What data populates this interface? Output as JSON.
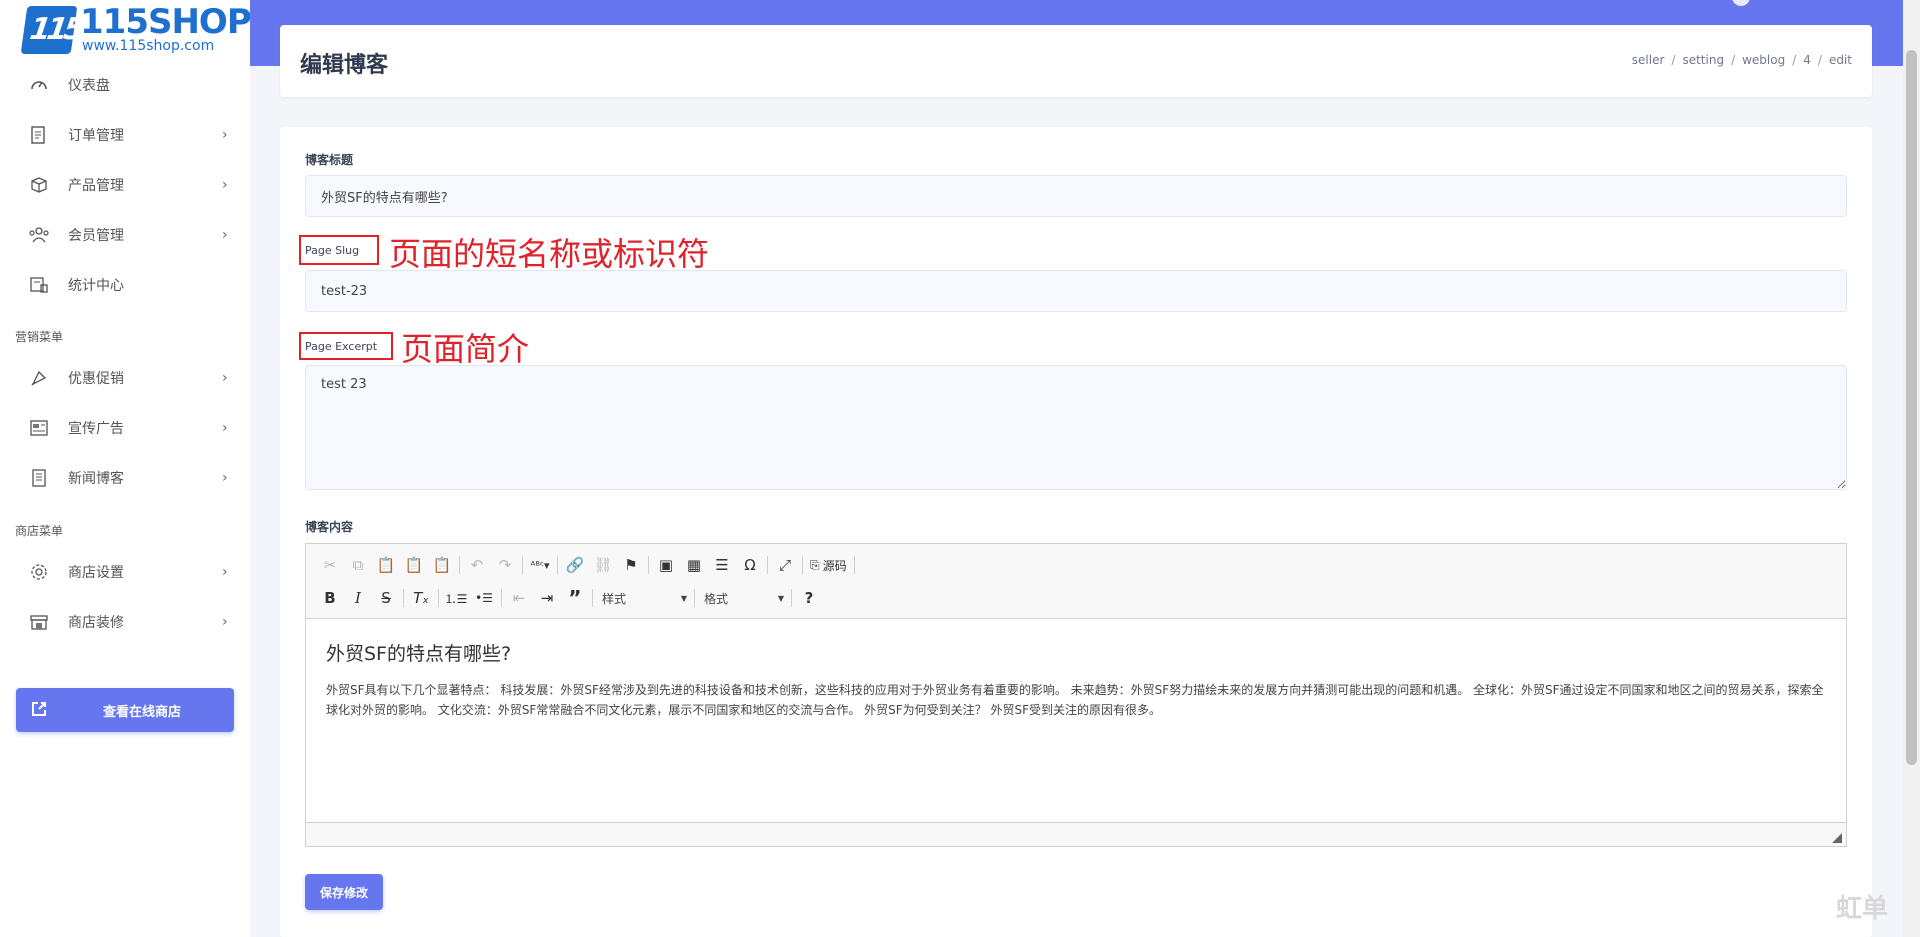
{
  "brand": {
    "name": "115SHOP",
    "url": "www.115shop.com",
    "mark": "115"
  },
  "sidebar": {
    "items": [
      {
        "label": "仪表盘",
        "icon": "dashboard-icon",
        "arrow": ""
      },
      {
        "label": "订单管理",
        "icon": "order-icon",
        "arrow": "›"
      },
      {
        "label": "产品管理",
        "icon": "product-icon",
        "arrow": "›"
      },
      {
        "label": "会员管理",
        "icon": "members-icon",
        "arrow": "›"
      },
      {
        "label": "统计中心",
        "icon": "stats-icon",
        "arrow": ""
      }
    ],
    "section_marketing": "营销菜单",
    "marketing_items": [
      {
        "label": "优惠促销",
        "icon": "promotion-icon",
        "arrow": "›"
      },
      {
        "label": "宣传广告",
        "icon": "ads-icon",
        "arrow": "›"
      },
      {
        "label": "新闻博客",
        "icon": "news-icon",
        "arrow": "›"
      }
    ],
    "section_shop": "商店菜单",
    "shop_items": [
      {
        "label": "商店设置",
        "icon": "settings-icon",
        "arrow": "›"
      },
      {
        "label": "商店装修",
        "icon": "decoration-icon",
        "arrow": "›"
      }
    ],
    "view_shop_button": "查看在线商店"
  },
  "header": {
    "title": "编辑博客",
    "breadcrumb": [
      "seller",
      "setting",
      "weblog",
      "4",
      "edit"
    ],
    "separator": "/"
  },
  "form": {
    "title_label": "博客标题",
    "title_value": "外贸SF的特点有哪些?",
    "slug_label": "Page Slug",
    "slug_annotation": "页面的短名称或标识符",
    "slug_value": "test-23",
    "excerpt_label": "Page Excerpt",
    "excerpt_annotation": "页面简介",
    "excerpt_value": "test 23",
    "content_label": "博客内容",
    "save_button": "保存修改"
  },
  "editor": {
    "source_label": "源码",
    "style_combo": "样式",
    "format_combo": "格式",
    "heading": "外贸SF的特点有哪些?",
    "body": "外贸SF具有以下几个显著特点： 科技发展：外贸SF经常涉及到先进的科技设备和技术创新，这些科技的应用对于外贸业务有着重要的影响。 未来趋势：外贸SF努力描绘未来的发展方向并猜测可能出现的问题和机遇。 全球化：外贸SF通过设定不同国家和地区之间的贸易关系，探索全球化对外贸的影响。 文化交流：外贸SF常常融合不同文化元素，展示不同国家和地区的交流与合作。 外贸SF为何受到关注？ 外贸SF受到关注的原因有很多。"
  },
  "watermark": "虹单",
  "colors": {
    "accent": "#6576ef",
    "annotation": "#e0222a",
    "brand": "#1f6fcf"
  }
}
